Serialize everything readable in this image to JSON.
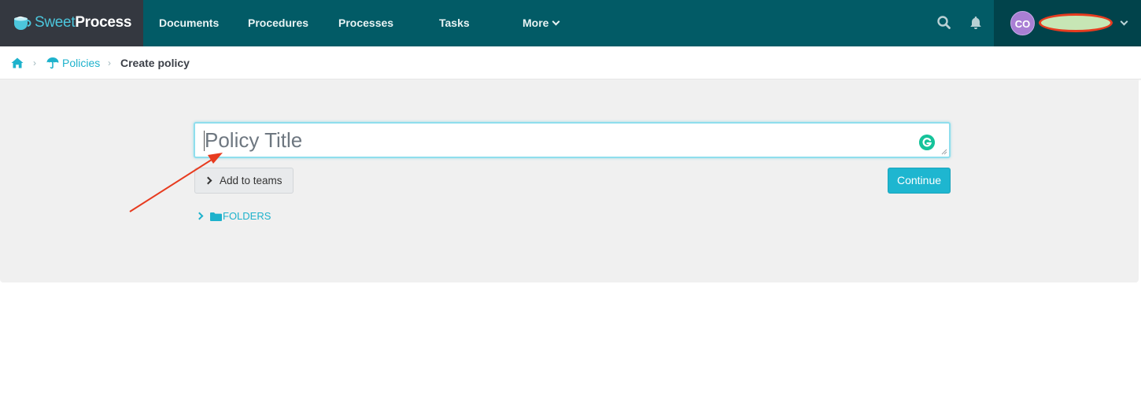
{
  "app": {
    "brand_sweet": "Sweet",
    "brand_process": "Process"
  },
  "nav": {
    "items": [
      {
        "label": "Documents"
      },
      {
        "label": "Procedures"
      },
      {
        "label": "Processes"
      },
      {
        "label": "Tasks"
      },
      {
        "label": "More"
      }
    ],
    "search_icon": "search-icon",
    "notifications_icon": "bell-icon"
  },
  "user": {
    "initials": "CO",
    "name_redacted": true
  },
  "breadcrumb": {
    "home_icon": "home-icon",
    "items": [
      {
        "label": "Policies",
        "icon": "umbrella-icon"
      },
      {
        "label": "Create policy"
      }
    ],
    "separator": "›"
  },
  "form": {
    "title_placeholder": "Policy Title",
    "title_value": "",
    "add_to_teams_label": "Add to teams",
    "continue_label": "Continue",
    "folders_label": "FOLDERS"
  },
  "colors": {
    "nav_bg": "#025b66",
    "brand_bg": "#343840",
    "user_bg": "#01434b",
    "accent": "#1eb6d0",
    "panel_bg": "#f0f0f0",
    "annotation": "#e73b1f"
  }
}
